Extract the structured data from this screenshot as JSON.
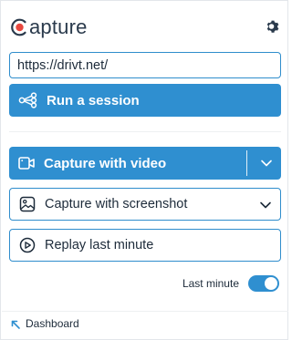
{
  "brand": {
    "name": "apture",
    "accent_color": "#e8483f",
    "primary_color": "#2f8fd0"
  },
  "header": {
    "settings_icon": "gear-icon"
  },
  "url_input": {
    "value": "https://drivt.net/"
  },
  "actions": {
    "run_session": {
      "label": "Run a session",
      "icon": "share-nodes-icon"
    },
    "capture_video": {
      "label": "Capture with video",
      "icon": "video-camera-icon",
      "menu_icon": "chevron-down-icon"
    },
    "capture_screenshot": {
      "label": "Capture with screenshot",
      "icon": "image-icon",
      "menu_icon": "chevron-down-icon"
    },
    "replay_last_minute": {
      "label": "Replay last minute",
      "icon": "play-circle-icon"
    }
  },
  "last_minute_toggle": {
    "label": "Last minute",
    "enabled": true
  },
  "footer": {
    "dashboard_label": "Dashboard",
    "dashboard_icon": "arrow-up-left-icon"
  }
}
